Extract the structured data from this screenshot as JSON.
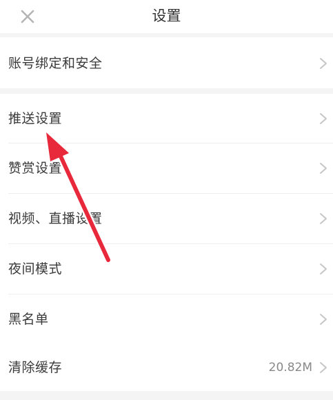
{
  "header": {
    "title": "设置"
  },
  "icons": {
    "close": "close-icon",
    "chevron": "chevron-right-icon"
  },
  "settings": {
    "account_security": "账号绑定和安全",
    "push": "推送设置",
    "reward": "赞赏设置",
    "video_live": "视频、直播设置",
    "night_mode": "夜间模式",
    "blacklist": "黑名单",
    "clear_cache": "清除缓存",
    "cache_size": "20.82M"
  },
  "colors": {
    "annotation_arrow": "#e8293b"
  }
}
